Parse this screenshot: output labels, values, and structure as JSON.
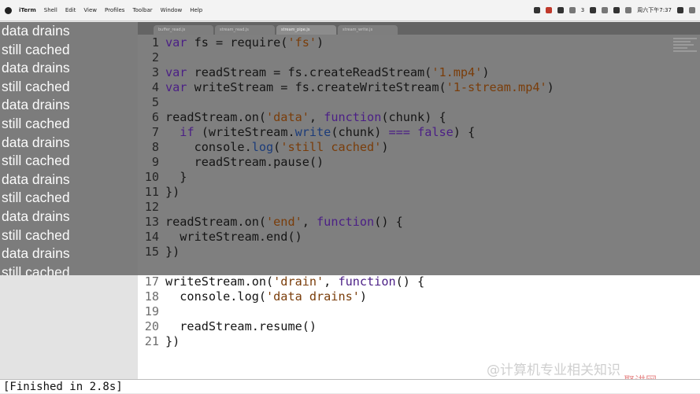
{
  "menubar": {
    "items": [
      "iTerm",
      "Shell",
      "Edit",
      "View",
      "Profiles",
      "Toolbar",
      "Window",
      "Help"
    ],
    "clock": "周六下午7:37",
    "battery": "3"
  },
  "terminal": {
    "lines": [
      "data drains",
      "still cached",
      "data drains",
      "still cached",
      "data drains",
      "still cached",
      "data drains",
      "still cached",
      "data drains",
      "still cached",
      "data drains",
      "still cached",
      "data drains",
      "still cached"
    ]
  },
  "editor": {
    "tabs": [
      "buffer_read.js",
      "stream_read.js",
      "stream_pipe.js",
      "stream_write.js"
    ],
    "line_numbers": [
      "1",
      "2",
      "3",
      "4",
      "5",
      "6",
      "7",
      "8",
      "9",
      "10",
      "11",
      "12",
      "13",
      "14",
      "15",
      "17",
      "18",
      "19",
      "20",
      "21"
    ]
  },
  "status": {
    "text": "[Finished in 2.8s]"
  },
  "watermark": {
    "text": "@计算机专业相关知识",
    "logo": "聚讲网"
  }
}
